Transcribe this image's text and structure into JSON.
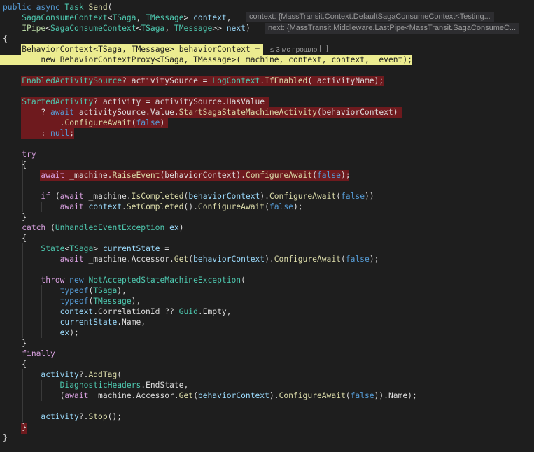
{
  "editor": {
    "lines": [
      [
        [
          "kw",
          "public "
        ],
        [
          "kw",
          "async "
        ],
        [
          "type",
          "Task "
        ],
        [
          "fn",
          "Send"
        ],
        [
          "plain",
          "("
        ]
      ],
      [
        [
          "plain",
          "    "
        ],
        [
          "type",
          "SagaConsumeContext"
        ],
        [
          "plain",
          "<"
        ],
        [
          "type",
          "TSaga"
        ],
        [
          "plain",
          ", "
        ],
        [
          "type",
          "TMessage"
        ],
        [
          "plain",
          "> "
        ],
        [
          "param",
          "context"
        ],
        [
          "plain",
          ","
        ]
      ],
      [
        [
          "plain",
          "    "
        ],
        [
          "iface",
          "IPipe"
        ],
        [
          "plain",
          "<"
        ],
        [
          "type",
          "SagaConsumeContext"
        ],
        [
          "plain",
          "<"
        ],
        [
          "type",
          "TSaga"
        ],
        [
          "plain",
          ", "
        ],
        [
          "type",
          "TMessage"
        ],
        [
          "plain",
          ">> "
        ],
        [
          "param",
          "next"
        ],
        [
          "plain",
          ")"
        ]
      ],
      [
        [
          "plain",
          "{"
        ]
      ],
      [
        [
          "plain",
          "    "
        ],
        [
          "type",
          "BehaviorContext"
        ],
        [
          "plain",
          "<"
        ],
        [
          "type",
          "TSaga"
        ],
        [
          "plain",
          ", "
        ],
        [
          "type",
          "TMessage"
        ],
        [
          "plain",
          "> "
        ],
        [
          "param",
          "behaviorContext"
        ],
        [
          "plain",
          " ="
        ]
      ],
      [
        [
          "plain",
          "        "
        ],
        [
          "kw",
          "new "
        ],
        [
          "type",
          "BehaviorContextProxy"
        ],
        [
          "plain",
          "<"
        ],
        [
          "type",
          "TSaga"
        ],
        [
          "plain",
          ", "
        ],
        [
          "type",
          "TMessage"
        ],
        [
          "plain",
          ">("
        ],
        [
          "plain",
          "_machine, context, context, _event);"
        ]
      ],
      [
        [
          "plain",
          ""
        ]
      ],
      [
        [
          "plain",
          "    "
        ],
        [
          "type",
          "EnabledActivitySource"
        ],
        [
          "plain",
          "? activitySource = "
        ],
        [
          "type",
          "LogContext"
        ],
        [
          "plain",
          "."
        ],
        [
          "fn",
          "IfEnabled"
        ],
        [
          "plain",
          "(_activityName);"
        ]
      ],
      [
        [
          "plain",
          ""
        ]
      ],
      [
        [
          "plain",
          "    "
        ],
        [
          "type",
          "StartedActivity"
        ],
        [
          "plain",
          "? activity = activitySource.HasValue"
        ]
      ],
      [
        [
          "plain",
          "        ? "
        ],
        [
          "kw",
          "await "
        ],
        [
          "plain",
          "activitySource.Value."
        ],
        [
          "fn",
          "StartSagaStateMachineActivity"
        ],
        [
          "plain",
          "(behaviorContext)"
        ]
      ],
      [
        [
          "plain",
          "            ."
        ],
        [
          "fn",
          "ConfigureAwait"
        ],
        [
          "plain",
          "("
        ],
        [
          "kw",
          "false"
        ],
        [
          "plain",
          ")"
        ]
      ],
      [
        [
          "plain",
          "        : "
        ],
        [
          "kw",
          "null"
        ],
        [
          "plain",
          ";"
        ]
      ],
      [
        [
          "plain",
          ""
        ]
      ],
      [
        [
          "plain",
          "    "
        ],
        [
          "ctl",
          "try"
        ]
      ],
      [
        [
          "plain",
          "    {"
        ]
      ],
      [
        [
          "plain",
          "        "
        ],
        [
          "ctl",
          "await "
        ],
        [
          "plain",
          "_machine."
        ],
        [
          "fn",
          "RaiseEvent"
        ],
        [
          "plain",
          "(behaviorContext)."
        ],
        [
          "fn",
          "ConfigureAwait"
        ],
        [
          "plain",
          "("
        ],
        [
          "kw",
          "false"
        ],
        [
          "plain",
          ");"
        ]
      ],
      [
        [
          "plain",
          ""
        ]
      ],
      [
        [
          "plain",
          "        "
        ],
        [
          "ctl",
          "if "
        ],
        [
          "plain",
          "("
        ],
        [
          "ctl",
          "await "
        ],
        [
          "plain",
          "_machine."
        ],
        [
          "fn",
          "IsCompleted"
        ],
        [
          "plain",
          "("
        ],
        [
          "param",
          "behaviorContext"
        ],
        [
          "plain",
          ")."
        ],
        [
          "fn",
          "ConfigureAwait"
        ],
        [
          "plain",
          "("
        ],
        [
          "kw",
          "false"
        ],
        [
          "plain",
          "))"
        ]
      ],
      [
        [
          "plain",
          "            "
        ],
        [
          "ctl",
          "await "
        ],
        [
          "param",
          "context"
        ],
        [
          "plain",
          "."
        ],
        [
          "fn",
          "SetCompleted"
        ],
        [
          "plain",
          "()."
        ],
        [
          "fn",
          "ConfigureAwait"
        ],
        [
          "plain",
          "("
        ],
        [
          "kw",
          "false"
        ],
        [
          "plain",
          ");"
        ]
      ],
      [
        [
          "plain",
          "    }"
        ]
      ],
      [
        [
          "plain",
          "    "
        ],
        [
          "ctl",
          "catch "
        ],
        [
          "plain",
          "("
        ],
        [
          "type",
          "UnhandledEventException "
        ],
        [
          "param",
          "ex"
        ],
        [
          "plain",
          ")"
        ]
      ],
      [
        [
          "plain",
          "    {"
        ]
      ],
      [
        [
          "plain",
          "        "
        ],
        [
          "type",
          "State"
        ],
        [
          "plain",
          "<"
        ],
        [
          "type",
          "TSaga"
        ],
        [
          "plain",
          "> "
        ],
        [
          "param",
          "currentState"
        ],
        [
          "plain",
          " ="
        ]
      ],
      [
        [
          "plain",
          "            "
        ],
        [
          "ctl",
          "await "
        ],
        [
          "plain",
          "_machine.Accessor."
        ],
        [
          "fn",
          "Get"
        ],
        [
          "plain",
          "("
        ],
        [
          "param",
          "behaviorContext"
        ],
        [
          "plain",
          ")."
        ],
        [
          "fn",
          "ConfigureAwait"
        ],
        [
          "plain",
          "("
        ],
        [
          "kw",
          "false"
        ],
        [
          "plain",
          ");"
        ]
      ],
      [
        [
          "plain",
          ""
        ]
      ],
      [
        [
          "plain",
          "        "
        ],
        [
          "ctl",
          "throw "
        ],
        [
          "kw",
          "new "
        ],
        [
          "type",
          "NotAcceptedStateMachineException"
        ],
        [
          "plain",
          "("
        ]
      ],
      [
        [
          "plain",
          "            "
        ],
        [
          "kw",
          "typeof"
        ],
        [
          "plain",
          "("
        ],
        [
          "type",
          "TSaga"
        ],
        [
          "plain",
          "),"
        ]
      ],
      [
        [
          "plain",
          "            "
        ],
        [
          "kw",
          "typeof"
        ],
        [
          "plain",
          "("
        ],
        [
          "type",
          "TMessage"
        ],
        [
          "plain",
          "),"
        ]
      ],
      [
        [
          "plain",
          "            "
        ],
        [
          "param",
          "context"
        ],
        [
          "plain",
          ".CorrelationId ?? "
        ],
        [
          "type",
          "Guid"
        ],
        [
          "plain",
          ".Empty,"
        ]
      ],
      [
        [
          "plain",
          "            "
        ],
        [
          "param",
          "currentState"
        ],
        [
          "plain",
          ".Name,"
        ]
      ],
      [
        [
          "plain",
          "            "
        ],
        [
          "param",
          "ex"
        ],
        [
          "plain",
          ");"
        ]
      ],
      [
        [
          "plain",
          "    }"
        ]
      ],
      [
        [
          "plain",
          "    "
        ],
        [
          "ctl",
          "finally"
        ]
      ],
      [
        [
          "plain",
          "    {"
        ]
      ],
      [
        [
          "plain",
          "        "
        ],
        [
          "param",
          "activity"
        ],
        [
          "plain",
          "?."
        ],
        [
          "fn",
          "AddTag"
        ],
        [
          "plain",
          "("
        ]
      ],
      [
        [
          "plain",
          "            "
        ],
        [
          "type",
          "DiagnosticHeaders"
        ],
        [
          "plain",
          ".EndState,"
        ]
      ],
      [
        [
          "plain",
          "            ("
        ],
        [
          "ctl",
          "await "
        ],
        [
          "plain",
          "_machine.Accessor."
        ],
        [
          "fn",
          "Get"
        ],
        [
          "plain",
          "("
        ],
        [
          "param",
          "behaviorContext"
        ],
        [
          "plain",
          ")."
        ],
        [
          "fn",
          "ConfigureAwait"
        ],
        [
          "plain",
          "("
        ],
        [
          "kw",
          "false"
        ],
        [
          "plain",
          ")).Name);"
        ]
      ],
      [
        [
          "plain",
          ""
        ]
      ],
      [
        [
          "plain",
          "        "
        ],
        [
          "param",
          "activity"
        ],
        [
          "plain",
          "?."
        ],
        [
          "fn",
          "Stop"
        ],
        [
          "plain",
          "();"
        ]
      ],
      [
        [
          "plain",
          "    }"
        ]
      ],
      [
        [
          "plain",
          "}"
        ]
      ]
    ]
  },
  "datatips": {
    "context": "context: {MassTransit.Context.DefaultSagaConsumeContext<Testing...",
    "next": "next: {MassTransit.Middleware.LastPipe<MassTransit.SagaConsumeC..."
  },
  "codelens": {
    "elapsed": "≤ 3 мс прошло"
  },
  "colors": {
    "background": "#1e1e1e",
    "breakpoint_highlight": "#6e1a1e",
    "current_statement": "#ecec90",
    "keyword": "#569cd6",
    "control": "#d8a0df",
    "type": "#4ec9b0",
    "method": "#dcdcaa",
    "parameter": "#9cdcfe"
  }
}
